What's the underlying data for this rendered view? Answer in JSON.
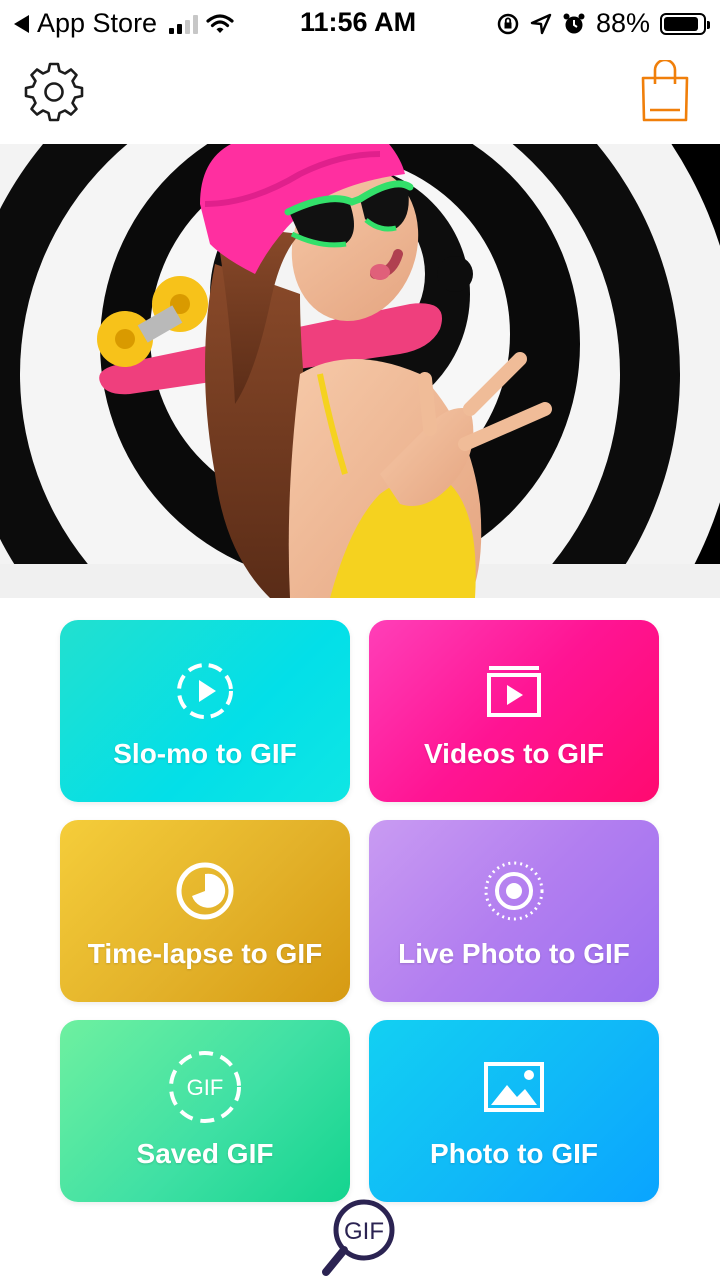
{
  "status_bar": {
    "back_app": "App Store",
    "time": "11:56 AM",
    "battery": "88%",
    "battery_level": 0.88
  },
  "top_bar": {
    "settings_icon": "gear-icon",
    "shop_icon": "shopping-bag-icon",
    "accent_color": "#f07f0a"
  },
  "hero": {
    "image": "woman-with-skateboard-on-spiral-background"
  },
  "tiles": [
    {
      "label": "Slo-mo to GIF",
      "icon": "slowmo-play-icon"
    },
    {
      "label": "Videos to GIF",
      "icon": "video-library-icon"
    },
    {
      "label": "Time-lapse to GIF",
      "icon": "timelapse-icon"
    },
    {
      "label": "Live Photo to GIF",
      "icon": "live-photo-icon"
    },
    {
      "label": "Saved GIF",
      "icon": "saved-gif-icon",
      "icon_text": "GIF"
    },
    {
      "label": "Photo to GIF",
      "icon": "photo-icon"
    }
  ],
  "bottom": {
    "search_icon_text": "GIF",
    "search_icon": "gif-search-icon"
  }
}
